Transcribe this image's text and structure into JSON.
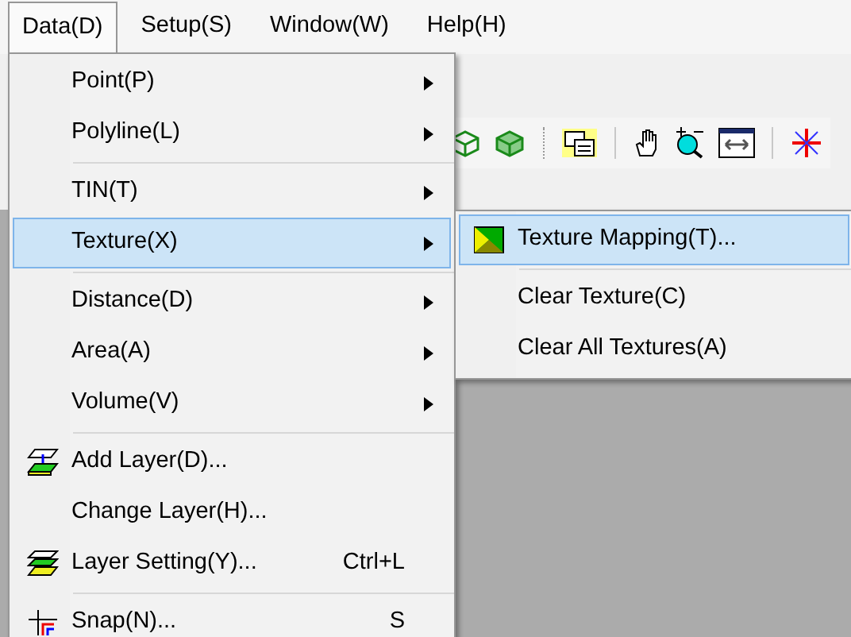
{
  "menubar": [
    {
      "label": "Data(D)",
      "selected": true
    },
    {
      "label": "Setup(S)",
      "selected": false
    },
    {
      "label": "Window(W)",
      "selected": false
    },
    {
      "label": "Help(H)",
      "selected": false
    }
  ],
  "data_menu": [
    {
      "kind": "submenu",
      "label": "Point(P)",
      "selected": false
    },
    {
      "kind": "submenu",
      "label": "Polyline(L)",
      "selected": false
    },
    {
      "kind": "separator"
    },
    {
      "kind": "submenu",
      "label": "TIN(T)",
      "selected": false
    },
    {
      "kind": "submenu",
      "label": "Texture(X)",
      "selected": true
    },
    {
      "kind": "separator"
    },
    {
      "kind": "submenu",
      "label": "Distance(D)",
      "selected": false
    },
    {
      "kind": "submenu",
      "label": "Area(A)",
      "selected": false
    },
    {
      "kind": "submenu",
      "label": "Volume(V)",
      "selected": false
    },
    {
      "kind": "separator"
    },
    {
      "kind": "command",
      "label": "Add Layer(D)...",
      "selected": false
    },
    {
      "kind": "command",
      "label": "Change Layer(H)...",
      "selected": false
    },
    {
      "kind": "command",
      "label": "Layer Setting(Y)...",
      "shortcut": "Ctrl+L",
      "selected": false
    },
    {
      "kind": "separator"
    },
    {
      "kind": "command",
      "label": "Snap(N)...",
      "shortcut": "S",
      "selected": false
    }
  ],
  "texture_submenu": [
    {
      "kind": "command",
      "label": "Texture Mapping(T)...",
      "selected": true
    },
    {
      "kind": "separator"
    },
    {
      "kind": "command",
      "label": "Clear Texture(C)",
      "selected": false
    },
    {
      "kind": "command",
      "label": "Clear All Textures(A)",
      "selected": false
    }
  ]
}
